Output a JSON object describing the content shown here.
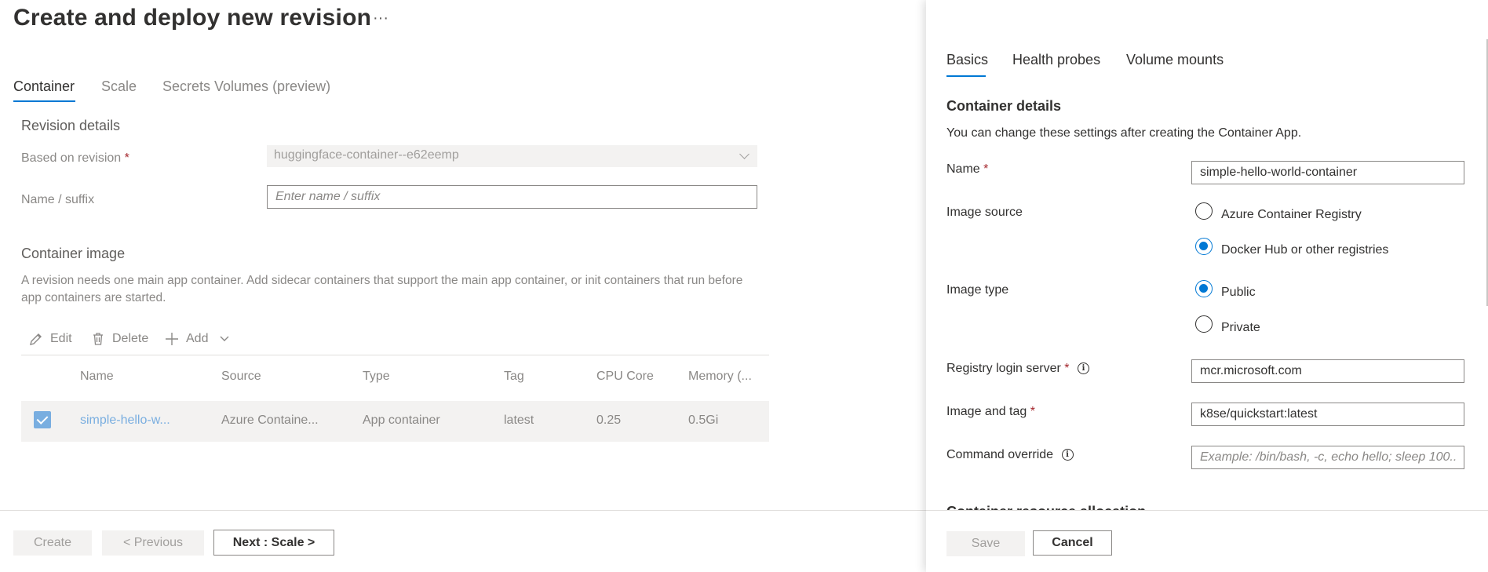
{
  "page": {
    "title": "Create and deploy new revision",
    "more_icon": "ellipsis-icon",
    "more_glyph": "···"
  },
  "tabs": [
    {
      "label": "Container",
      "active": true
    },
    {
      "label": "Scale",
      "active": false
    },
    {
      "label": "Secrets Volumes (preview)",
      "active": false
    }
  ],
  "revision_details": {
    "title": "Revision details",
    "based_on_label": "Based on revision",
    "based_on_required": "*",
    "based_on_value": "huggingface-container--e62eemp",
    "name_suffix_label": "Name / suffix",
    "name_suffix_placeholder": "Enter name / suffix"
  },
  "container_image": {
    "title": "Container image",
    "description": "A revision needs one main app container. Add sidecar containers that support the main app container, or init containers that run before app containers are started.",
    "toolbar": {
      "edit": "Edit",
      "delete": "Delete",
      "add": "Add"
    },
    "columns": [
      "Name",
      "Source",
      "Type",
      "Tag",
      "CPU Core",
      "Memory (..."
    ],
    "rows": [
      {
        "name": "simple-hello-w...",
        "source": "Azure Containe...",
        "type": "App container",
        "tag": "latest",
        "cpu": "0.25",
        "memory": "0.5Gi",
        "checked": true
      }
    ]
  },
  "footer": {
    "create": "Create",
    "previous": "< Previous",
    "next": "Next : Scale >"
  },
  "panel": {
    "tabs": [
      {
        "label": "Basics",
        "active": true
      },
      {
        "label": "Health probes",
        "active": false
      },
      {
        "label": "Volume mounts",
        "active": false
      }
    ],
    "section_title": "Container details",
    "section_desc": "You can change these settings after creating the Container App.",
    "name_label": "Name",
    "name_required": "*",
    "name_value": "simple-hello-world-container",
    "image_source_label": "Image source",
    "image_source_options": [
      {
        "label": "Azure Container Registry",
        "checked": false
      },
      {
        "label": "Docker Hub or other registries",
        "checked": true
      }
    ],
    "image_type_label": "Image type",
    "image_type_options": [
      {
        "label": "Public",
        "checked": true
      },
      {
        "label": "Private",
        "checked": false
      }
    ],
    "registry_label": "Registry login server",
    "registry_required": "*",
    "registry_value": "mcr.microsoft.com",
    "image_tag_label": "Image and tag",
    "image_tag_required": "*",
    "image_tag_value": "k8se/quickstart:latest",
    "command_label": "Command override",
    "command_placeholder": "Example: /bin/bash, -c, echo hello; sleep 100...",
    "next_section_partial": "Container resource allocation",
    "info_glyph": "i",
    "save": "Save",
    "cancel": "Cancel"
  },
  "colors": {
    "accent": "#0078d4",
    "required": "#a4262c"
  }
}
